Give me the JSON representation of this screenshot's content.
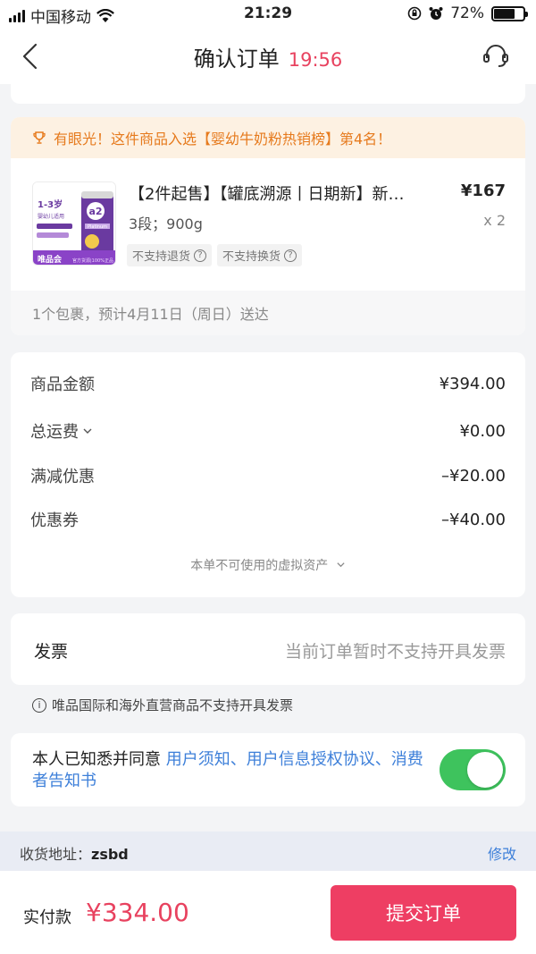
{
  "status_bar": {
    "carrier": "中国移动",
    "time": "21:29",
    "battery": "72%",
    "battery_level": 0.72
  },
  "nav": {
    "title": "确认订单",
    "countdown": "19:56"
  },
  "product": {
    "promo": "有眼光！这件商品入选【婴幼牛奶粉热销榜】第4名！",
    "name": "【2件起售】【罐底溯源丨日期新】新…",
    "price": "¥167",
    "spec": "3段；900g",
    "quantity": "x 2",
    "tags": [
      "不支持退货",
      "不支持换货"
    ],
    "thumb": {
      "age": "1-3岁",
      "sub": "婴幼儿适用",
      "brand": "a2",
      "series": "Platinum",
      "shop": "唯品会"
    },
    "delivery": "1个包裹，预计4月11日（周日）送达"
  },
  "amounts": {
    "rows": [
      {
        "label": "商品金额",
        "value": "¥394.00"
      },
      {
        "label": "总运费",
        "value": "¥0.00"
      },
      {
        "label": "满减优惠",
        "value": "–¥20.00"
      },
      {
        "label": "优惠券",
        "value": "–¥40.00"
      }
    ],
    "virtual_assets": "本单不可使用的虚拟资产"
  },
  "invoice": {
    "label": "发票",
    "value": "当前订单暂时不支持开具发票",
    "note": "唯品国际和海外直营商品不支持开具发票"
  },
  "agreement": {
    "prefix": "本人已知悉并同意",
    "links": "用户须知、用户信息授权协议、消费者告知书",
    "enabled": true
  },
  "address": {
    "label": "收货地址：",
    "value": "zsbd",
    "edit": "修改"
  },
  "footer": {
    "paid_label": "实付款",
    "paid_amount": "¥334.00",
    "submit": "提交订单"
  },
  "colors": {
    "accent": "#e8425f",
    "link": "#3d7fd9",
    "toggle": "#3ec35d",
    "promo_text": "#e67a1d"
  }
}
